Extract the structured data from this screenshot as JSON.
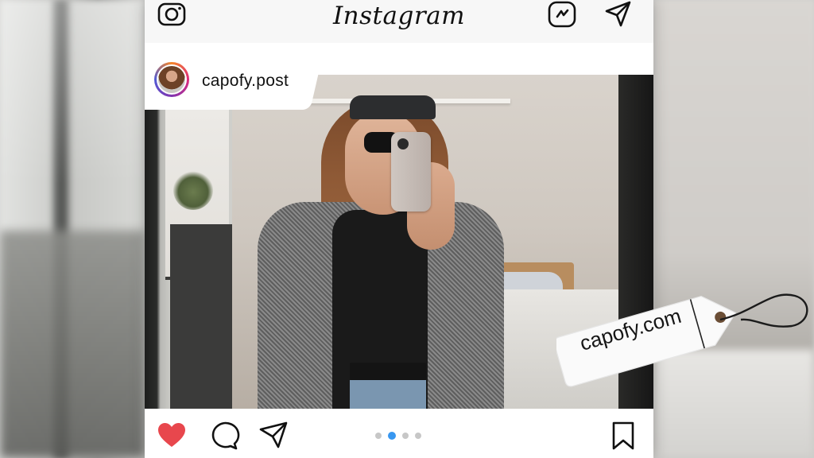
{
  "app": {
    "title": "Instagram"
  },
  "topbar": {
    "camera_icon": "camera-icon",
    "reels_icon": "reels-icon",
    "send_icon": "direct-message-icon"
  },
  "post": {
    "username": "capofy.post",
    "carousel": {
      "count": 4,
      "active_index": 1
    },
    "actions": [
      "heart-icon",
      "comment-icon",
      "share-icon",
      "bookmark-icon"
    ],
    "colors": {
      "like": "#e8474d",
      "active_dot": "#3897f0"
    }
  },
  "tag": {
    "label": "capofy.com"
  }
}
